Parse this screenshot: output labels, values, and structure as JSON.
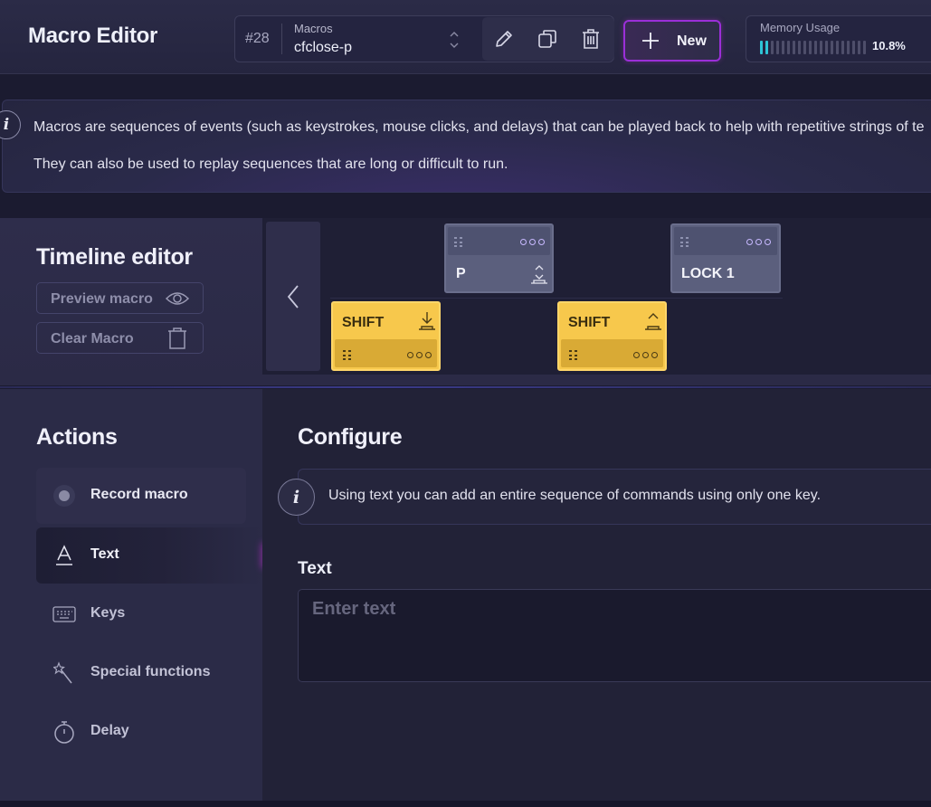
{
  "app": {
    "title": "Macro Editor"
  },
  "macro_selector": {
    "number": "#28",
    "label": "Macros",
    "value": "cfclose-p"
  },
  "toolbar": {
    "new_label": "New"
  },
  "memory": {
    "label": "Memory Usage",
    "value": "10.8%",
    "fraction": 0.108,
    "accent_color": "#2ec4d6"
  },
  "info_banner": {
    "line1": "Macros are sequences of events (such as keystrokes, mouse clicks, and delays) that can be played back to help with repetitive strings of te",
    "line2": "They can also be used to replay sequences that are long or difficult to run."
  },
  "timeline": {
    "title": "Timeline editor",
    "preview_label": "Preview macro",
    "clear_label": "Clear Macro",
    "blocks": [
      {
        "label": "P",
        "color": "gray",
        "icon": "key-up-down-icon"
      },
      {
        "label": "LOCK 1",
        "color": "gray",
        "icon": "none"
      },
      {
        "label": "SHIFT",
        "color": "yellow",
        "icon": "key-down-icon"
      },
      {
        "label": "SHIFT",
        "color": "yellow",
        "icon": "key-up-icon"
      }
    ]
  },
  "actions": {
    "title": "Actions",
    "items": [
      {
        "label": "Record macro",
        "icon": "record-icon"
      },
      {
        "label": "Text",
        "icon": "text-icon",
        "active": true
      },
      {
        "label": "Keys",
        "icon": "keyboard-icon"
      },
      {
        "label": "Special functions",
        "icon": "magic-wand-icon"
      },
      {
        "label": "Delay",
        "icon": "stopwatch-icon"
      }
    ]
  },
  "configure": {
    "title": "Configure",
    "info": "Using text you can add an entire sequence of commands using only one key.",
    "text_label": "Text",
    "text_placeholder": "Enter text",
    "text_value": ""
  },
  "colors": {
    "accent_purple": "#c42fd6",
    "block_yellow": "#f7c84c",
    "block_gray": "#5b5f7d"
  }
}
